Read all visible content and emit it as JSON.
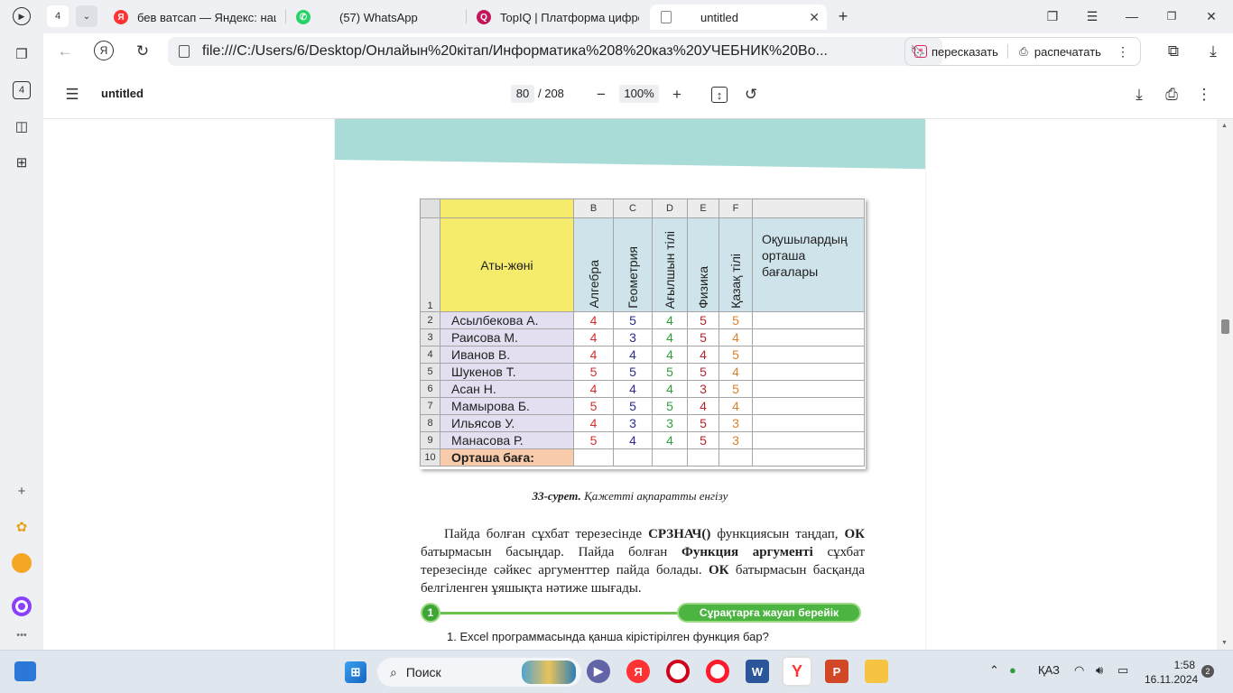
{
  "browser": {
    "tab_count": "4",
    "tabs": [
      {
        "label": "бев ватсап — Яндекс: нашлось",
        "icon": "yandex-icon"
      },
      {
        "label": "(57) WhatsApp",
        "icon": "whatsapp-icon"
      },
      {
        "label": "TopIQ | Платформа цифров",
        "icon": "topiq-icon"
      },
      {
        "label": "untitled",
        "icon": "pdf-file-icon"
      }
    ],
    "url": "file:///C:/Users/6/Desktop/Онлайын%20кітап/Информатика%208%20каз%20УЧЕБНИК%20Во...",
    "retell_label": "пересказать",
    "print_label": "распечатать"
  },
  "pdf_toolbar": {
    "title": "untitled",
    "current_page": "80",
    "total_pages": "/ 208",
    "zoom": "100%"
  },
  "figure": {
    "col_letters": [
      "B",
      "C",
      "D",
      "E",
      "F"
    ],
    "name_header": "Аты-жөні",
    "subjects": [
      "Алгебра",
      "Геометрия",
      "Ағылшын тілі",
      "Физика",
      "Қазақ тілі"
    ],
    "avg_header": [
      "Оқушылардың",
      "орташа",
      "бағалары"
    ],
    "header_row_num": "1",
    "rows": [
      {
        "num": "2",
        "name": "Асылбекова А.",
        "grades": [
          "4",
          "5",
          "4",
          "5",
          "5"
        ]
      },
      {
        "num": "3",
        "name": "Раисова М.",
        "grades": [
          "4",
          "3",
          "4",
          "5",
          "4"
        ]
      },
      {
        "num": "4",
        "name": "Иванов В.",
        "grades": [
          "4",
          "4",
          "4",
          "4",
          "5"
        ]
      },
      {
        "num": "5",
        "name": "Шукенов Т.",
        "grades": [
          "5",
          "5",
          "5",
          "5",
          "4"
        ]
      },
      {
        "num": "6",
        "name": "Асан Н.",
        "grades": [
          "4",
          "4",
          "4",
          "3",
          "5"
        ]
      },
      {
        "num": "7",
        "name": "Мамырова Б.",
        "grades": [
          "5",
          "5",
          "5",
          "4",
          "4"
        ]
      },
      {
        "num": "8",
        "name": "Ильясов У.",
        "grades": [
          "4",
          "3",
          "3",
          "5",
          "3"
        ]
      },
      {
        "num": "9",
        "name": "Манасова Р.",
        "grades": [
          "5",
          "4",
          "4",
          "5",
          "3"
        ]
      }
    ],
    "avg_row_num": "10",
    "avg_row_label": "Орташа баға:",
    "grade_colors": [
      "#d32f2f",
      "#2e2a8c",
      "#2e9e3a",
      "#b3262e",
      "#d9822b"
    ]
  },
  "caption": {
    "number": "33-сурет.",
    "text": "Қажетті ақпаратты енгізу"
  },
  "paragraph": {
    "p1": "Пайда болған сұхбат терезесінде ",
    "b1": "СРЗНАЧ()",
    "p2": " функциясын таңдап, ",
    "b2": "ОК",
    "p3": " батырмасын басыңдар. Пайда болған ",
    "b3": "Функция аргументі",
    "p4": " сұхбат терезесінде сәйкес аргументтер пайда болады. ",
    "b4": "ОК",
    "p5": " батырмасын басқанда белгіленген ұяшықта нәтиже шығады."
  },
  "questions": {
    "section_number": "1",
    "section_title": "Сұрақтарға жауап берейік",
    "q1": "1.     Excel программасында қанша кірістірілген функция бар?"
  },
  "taskbar": {
    "search_label": "Поиск",
    "language": "ҚАЗ",
    "time": "1:58",
    "date": "16.11.2024",
    "notifications": "2"
  }
}
